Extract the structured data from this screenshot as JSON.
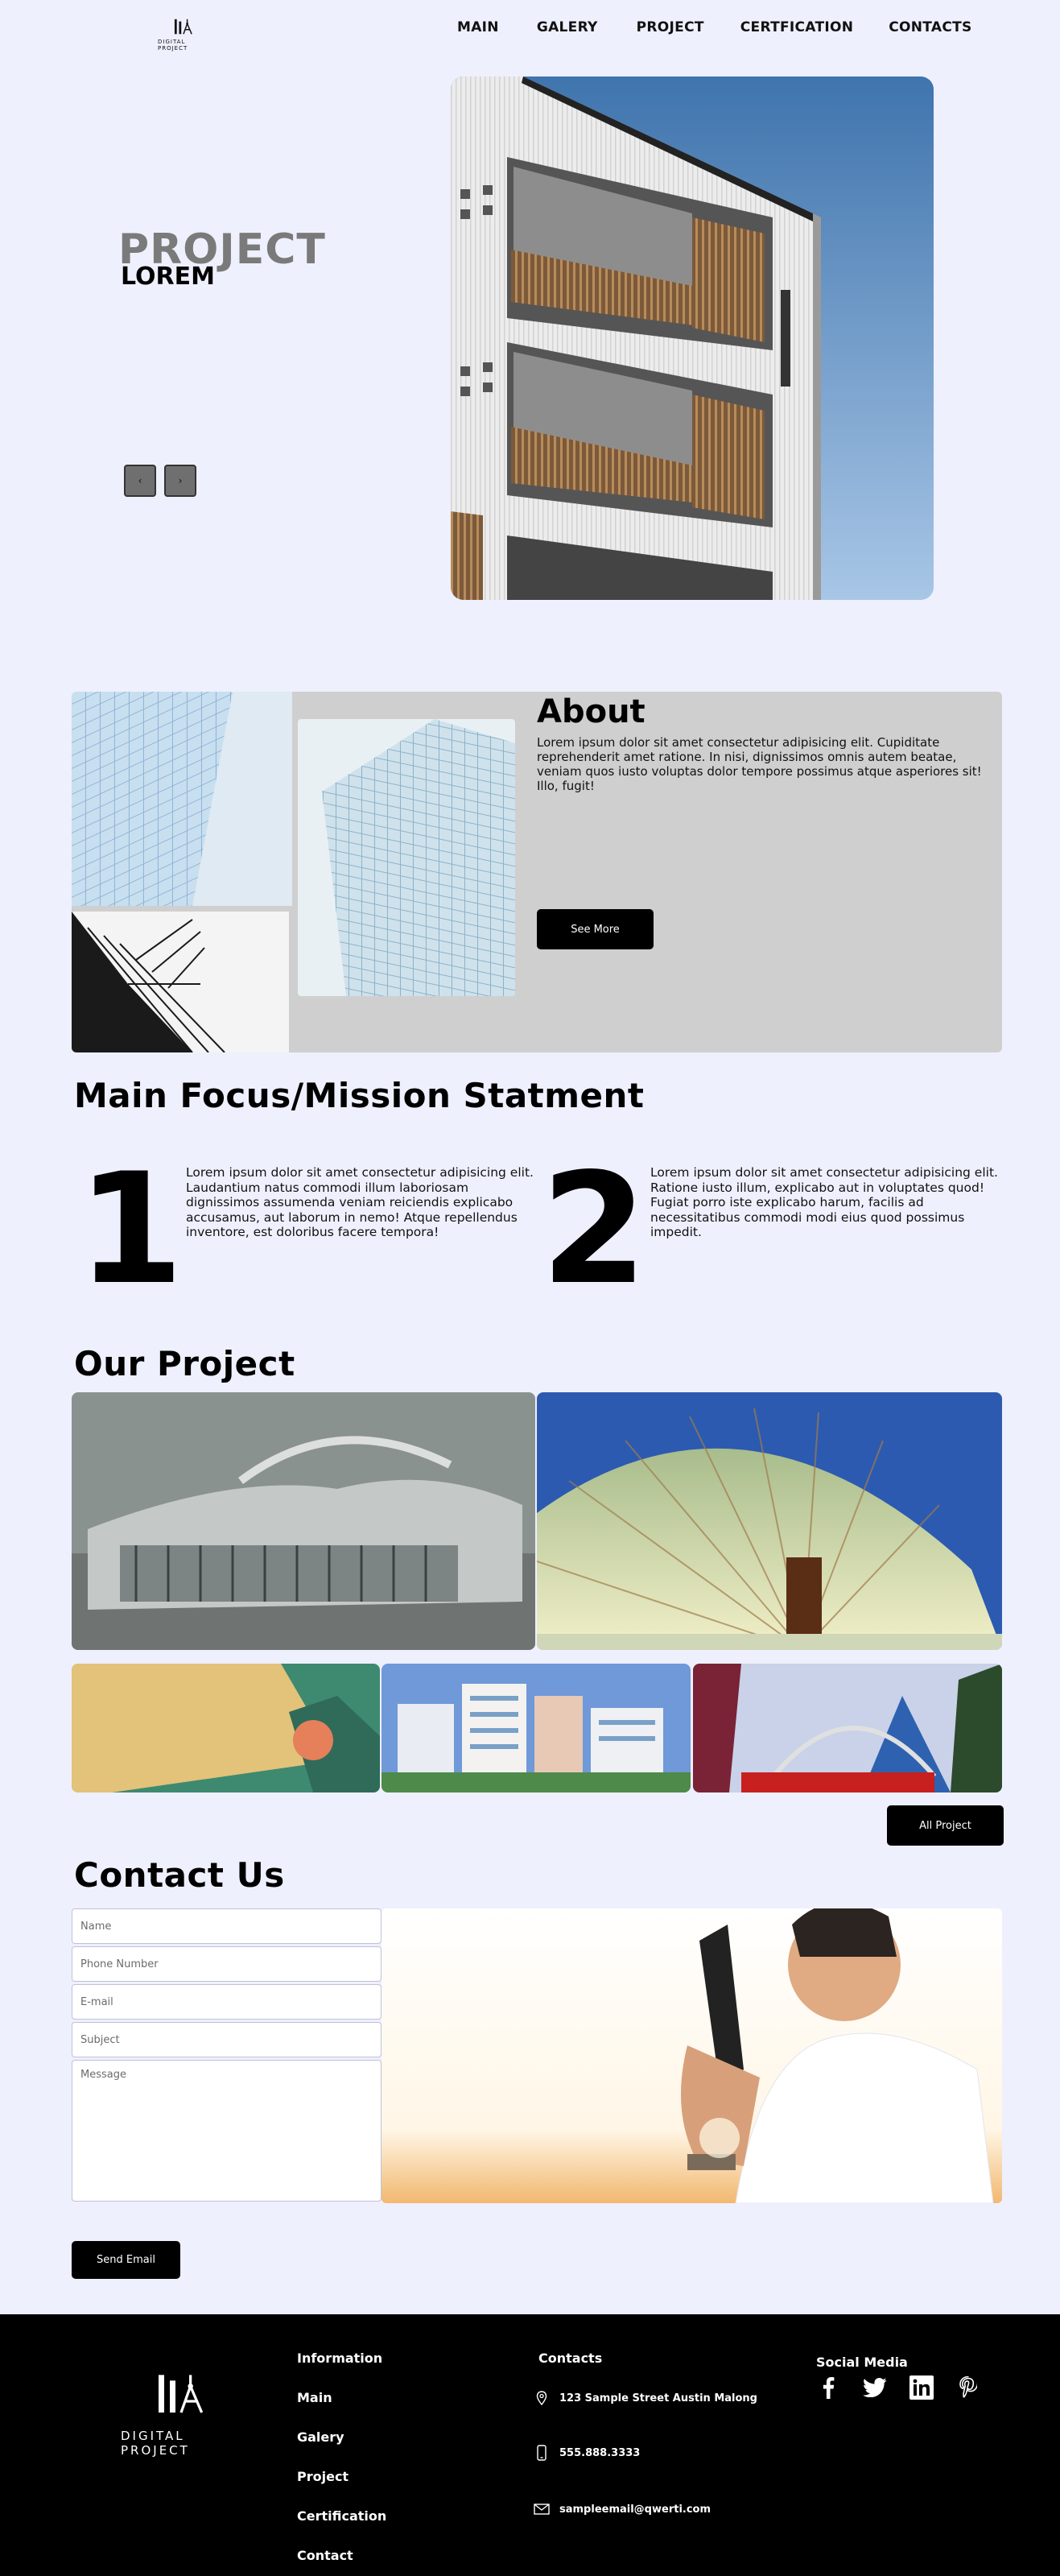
{
  "brand": {
    "logo_text": "DIGITAL PROJECT"
  },
  "nav": {
    "items": [
      "MAIN",
      "GALERY",
      "PROJECT",
      "CERTFICATION",
      "CONTACTS"
    ]
  },
  "hero": {
    "title": "PROJECT",
    "subtitle": "LOREM",
    "prev_label": "‹",
    "next_label": "›"
  },
  "about": {
    "title": "About",
    "body": "Lorem ipsum dolor sit amet consectetur adipisicing elit. Cupiditate reprehenderit amet ratione. In nisi, dignissimos omnis autem beatae, veniam quos iusto voluptas dolor tempore possimus atque asperiores sit! Illo, fugit!",
    "button": "See More"
  },
  "mission": {
    "title": "Main Focus/Mission Statment",
    "items": [
      {
        "number": "1",
        "text": "Lorem ipsum dolor sit amet consectetur adipisicing elit. Laudantium natus commodi illum laboriosam dignissimos assumenda veniam reiciendis explicabo accusamus, aut laborum in nemo! Atque repellendus inventore, est doloribus facere tempora!"
      },
      {
        "number": "2",
        "text": "Lorem ipsum dolor sit amet consectetur adipisicing elit. Ratione iusto illum, explicabo aut in voluptates quod! Fugiat porro iste explicabo harum, facilis ad necessitatibus commodi modi eius quod possimus impedit."
      }
    ]
  },
  "projects": {
    "title": "Our Project",
    "button": "All Project"
  },
  "contact": {
    "title": "Contact Us",
    "placeholders": {
      "name": "Name",
      "phone": "Phone Number",
      "email": "E-mail",
      "subject": "Subject",
      "message": "Message"
    },
    "button": "Send Email"
  },
  "footer": {
    "logo_text": "DIGITAL PROJECT",
    "info_heading": "Information",
    "links": [
      "Main",
      "Galery",
      "Project",
      "Certification",
      "Contact"
    ],
    "contacts_heading": "Contacts",
    "address": "123 Sample Street Austin Malong",
    "phone": "555.888.3333",
    "email": "sampleemail@qwerti.com",
    "social_heading": "Social Media",
    "social_icons": [
      "facebook-icon",
      "twitter-icon",
      "linkedin-icon",
      "pinterest-icon"
    ]
  }
}
